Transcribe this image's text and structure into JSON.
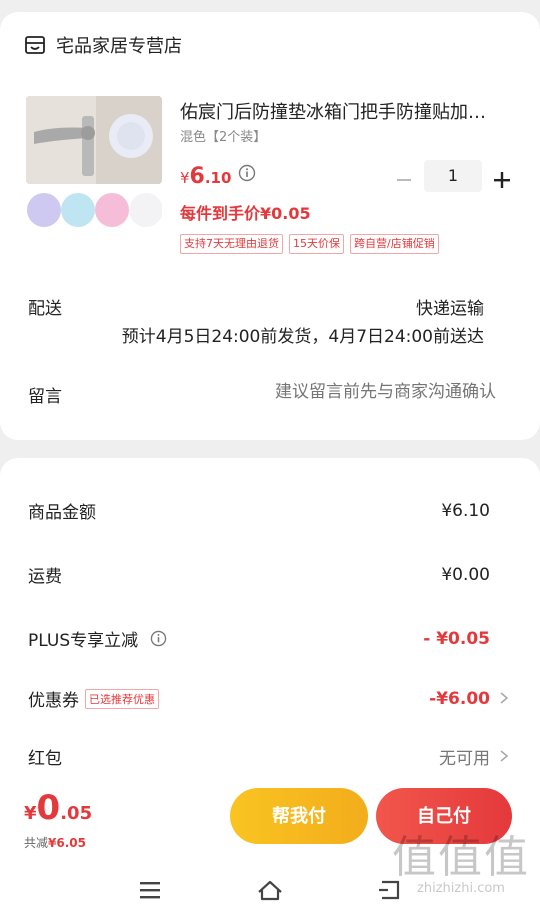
{
  "store": {
    "name": "宅品家居专营店",
    "icon": "store-icon"
  },
  "product": {
    "title": "佑宸门后防撞垫冰箱门把手防撞贴加厚静音",
    "variant": "混色【2个装】",
    "price_currency": "¥",
    "price_int": "6",
    "price_dec": ".10",
    "quantity": "1",
    "final_price_label": "每件到手价¥0.05",
    "tags": [
      "支持7天无理由退货",
      "15天价保",
      "跨自营/店铺促销"
    ]
  },
  "shipping": {
    "label": "配送",
    "method": "快递运输",
    "estimate": "预计4月5日24:00前发货，4月7日24:00前送达"
  },
  "message": {
    "label": "留言",
    "placeholder": "建议留言前先与商家沟通确认"
  },
  "summary": [
    {
      "label": "商品金额",
      "value": "¥6.10"
    },
    {
      "label": "运费",
      "value": "¥0.00"
    },
    {
      "label": "PLUS专享立减",
      "value": "- ¥0.05"
    },
    {
      "label": "优惠券",
      "badge": "已选推荐优惠",
      "value": "-¥6.00"
    },
    {
      "label": "红包",
      "value": "无可用"
    }
  ],
  "footer": {
    "total_currency": "¥",
    "total_int": "0",
    "total_dec": ".05",
    "saving_label": "共减",
    "saving_value": "¥6.05",
    "help_button": "帮我付",
    "self_button": "自己付"
  },
  "watermark": {
    "big": "值值值",
    "small": "zhizhizhi.com"
  },
  "colors": {
    "accent": "#e4393c",
    "help": "#f9c421",
    "pay": "#e4393c"
  }
}
